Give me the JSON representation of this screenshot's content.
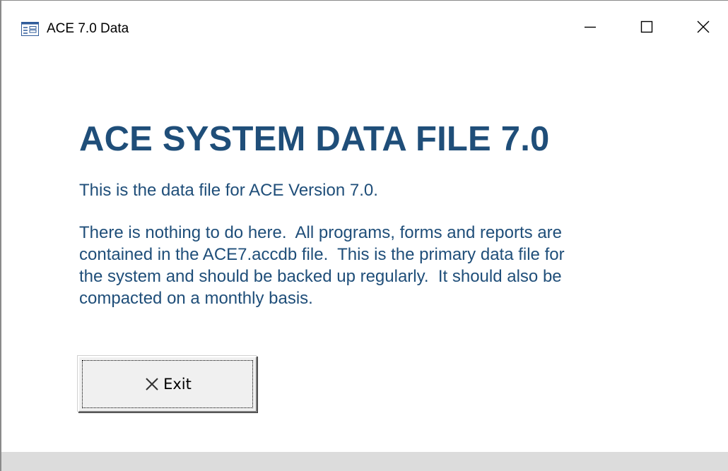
{
  "window": {
    "title": "ACE 7.0 Data",
    "app_icon": "access-form-icon",
    "controls": {
      "minimize_icon": "minimize-icon",
      "maximize_icon": "maximize-icon",
      "close_icon": "close-icon"
    }
  },
  "form": {
    "heading": "ACE SYSTEM DATA FILE 7.0",
    "intro_line": "This is the data file for ACE Version 7.0.",
    "paragraph_lines": [
      "There is nothing to do here.  All programs, forms and reports are",
      "contained in the ACE7.accdb file.  This is the primary data file for",
      "the system and should be backed up regularly.  It should also be",
      "compacted on a monthly basis."
    ],
    "exit_button": {
      "label": "Exit",
      "icon": "x-icon"
    }
  },
  "colors": {
    "text_blue": "#1f4e79",
    "button_face": "#f0f0f0",
    "status_strip": "#dcdcdc"
  }
}
